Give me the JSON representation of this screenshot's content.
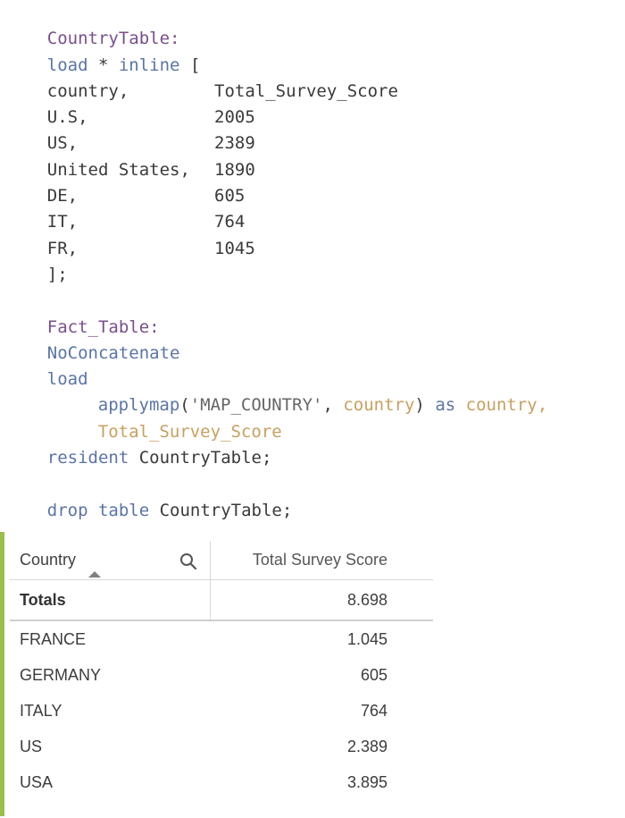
{
  "script": {
    "table1_label": "CountryTable:",
    "load_kw": "load",
    "load_rest": " * ",
    "inline_kw": "inline",
    "inline_open": " [",
    "header_col1": "country,",
    "header_col2": "Total_Survey_Score",
    "rows": [
      {
        "c1": "U.S,",
        "c2": "2005"
      },
      {
        "c1": "US,",
        "c2": "2389"
      },
      {
        "c1": "United States,",
        "c2": "1890"
      },
      {
        "c1": "DE,",
        "c2": "605"
      },
      {
        "c1": "IT,",
        "c2": "764"
      },
      {
        "c1": "FR,",
        "c2": "1045"
      }
    ],
    "inline_close": "];",
    "table2_label": "Fact_Table:",
    "noconcat_kw": "NoConcatenate",
    "load2_kw": "load",
    "applymap_fn": "applymap",
    "applymap_open": "(",
    "applymap_str": "'MAP_COUNTRY'",
    "applymap_comma": ", ",
    "applymap_arg": "country",
    "applymap_close": ")",
    "as_kw": " as ",
    "as_field": "country,",
    "field2": "Total_Survey_Score",
    "resident_kw": "resident",
    "resident_table": " CountryTable;",
    "drop_kw": "drop table",
    "drop_table": " CountryTable;"
  },
  "table": {
    "header_country": "Country",
    "header_score": "Total Survey Score",
    "totals_label": "Totals",
    "totals_value": "8.698",
    "rows": [
      {
        "country": "FRANCE",
        "score": "1.045"
      },
      {
        "country": "GERMANY",
        "score": "605"
      },
      {
        "country": "ITALY",
        "score": "764"
      },
      {
        "country": "US",
        "score": "2.389"
      },
      {
        "country": "USA",
        "score": "3.895"
      }
    ],
    "accent_color": "#9bc04a"
  }
}
